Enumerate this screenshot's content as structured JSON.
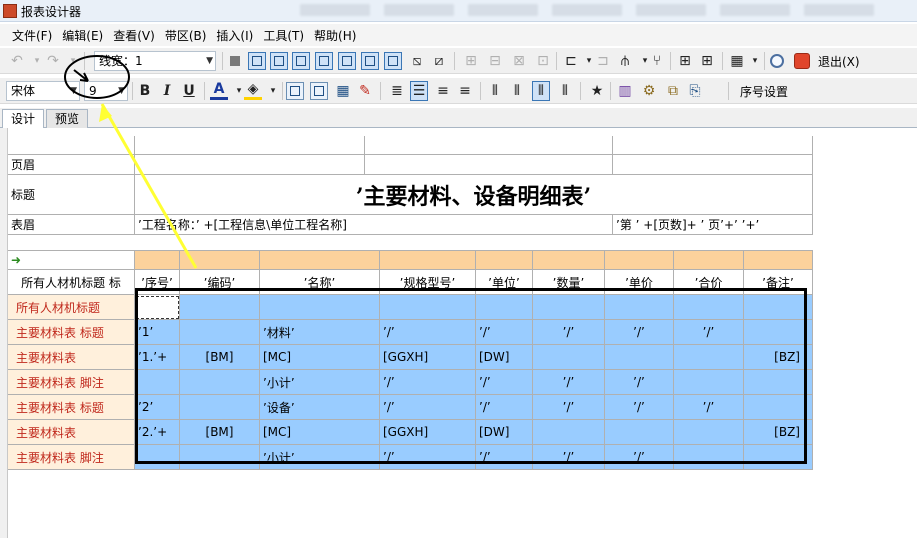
{
  "window": {
    "title": "报表设计器"
  },
  "menu": [
    "文件(F)",
    "编辑(E)",
    "查看(V)",
    "带区(B)",
    "插入(I)",
    "工具(T)",
    "帮助(H)"
  ],
  "toolbar1": {
    "line_width_label": "线宽：",
    "line_width_value": "1",
    "exit_label": "退出(X)"
  },
  "toolbar2": {
    "font_name": "宋体",
    "font_size": "9",
    "bold": "B",
    "italic": "I",
    "underline": "U",
    "font_color": "A",
    "seq_settings": "序号设置"
  },
  "tabs": [
    "设计",
    "预览"
  ],
  "report": {
    "band_labels": {
      "page_header": "页眉",
      "title": "标题",
      "table_header": "表眉"
    },
    "title_text": "’主要材料、设备明细表’",
    "project_name_expr": "’工程名称：’ +[工程信息\\单位工程名称]",
    "page_expr": "’第 ’ +[页数]+ ’ 页’+’ ’+’",
    "column_title_label": "所有人材机标题 标",
    "columns": [
      "’序号’",
      "’编码’",
      "’名称’",
      "’规格型号’",
      "’单位’",
      "’数量’",
      "’单价",
      "’合价",
      "’备注’"
    ],
    "rows": [
      {
        "label": "所有人材机标题",
        "cells": [
          "",
          "",
          "",
          "",
          "",
          "",
          "",
          "",
          ""
        ]
      },
      {
        "label": "主要材料表 标题",
        "cells": [
          "’1’",
          "",
          "’材料’",
          "’/’",
          "’/’",
          "’/’",
          "’/’",
          "’/’",
          ""
        ]
      },
      {
        "label": "主要材料表",
        "cells": [
          "’1.’+",
          "[BM]",
          "[MC]",
          "[GGXH]",
          "[DW]",
          "",
          "",
          "",
          "[BZ]"
        ]
      },
      {
        "label": "主要材料表 脚注",
        "cells": [
          "",
          "",
          "’小计’",
          "’/’",
          "’/’",
          "’/’",
          "’/’",
          "",
          ""
        ]
      },
      {
        "label": "主要材料表 标题",
        "cells": [
          "’2’",
          "",
          "’设备’",
          "’/’",
          "’/’",
          "’/’",
          "’/’",
          "’/’",
          ""
        ]
      },
      {
        "label": "主要材料表",
        "cells": [
          "’2.’+",
          "[BM]",
          "[MC]",
          "[GGXH]",
          "[DW]",
          "",
          "",
          "",
          "[BZ]"
        ]
      },
      {
        "label": "主要材料表 脚注",
        "cells": [
          "",
          "",
          "’小计’",
          "’/’",
          "’/’",
          "’/’",
          "’/’",
          "",
          ""
        ]
      }
    ]
  },
  "colors": {
    "orange": "#fcd29c",
    "blue": "#99ccff",
    "label_red": "#c0281c",
    "annotation": "#ffff33"
  }
}
